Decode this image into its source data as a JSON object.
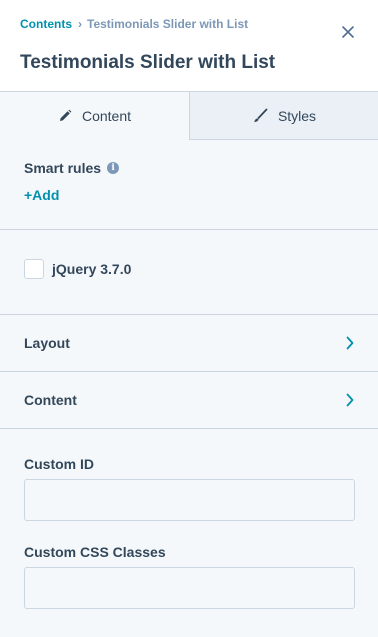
{
  "breadcrumb": {
    "parent": "Contents",
    "separator": "›",
    "current": "Testimonials Slider with List"
  },
  "header": {
    "title": "Testimonials Slider with List"
  },
  "tabs": [
    {
      "label": "Content",
      "icon": "pencil-icon",
      "active": true
    },
    {
      "label": "Styles",
      "icon": "brush-icon",
      "active": false
    }
  ],
  "smart_rules": {
    "label": "Smart rules",
    "info_icon": "i",
    "add_label": "+Add"
  },
  "jquery": {
    "label": "jQuery 3.7.0",
    "checked": false
  },
  "rows": [
    {
      "label": "Layout"
    },
    {
      "label": "Content"
    }
  ],
  "fields": {
    "custom_id": {
      "label": "Custom ID",
      "value": ""
    },
    "custom_css": {
      "label": "Custom CSS Classes",
      "value": ""
    }
  },
  "colors": {
    "accent": "#0091ae",
    "text": "#33475b",
    "muted": "#7c98b6",
    "border": "#cbd6e2",
    "panel": "#f5f8fa"
  }
}
